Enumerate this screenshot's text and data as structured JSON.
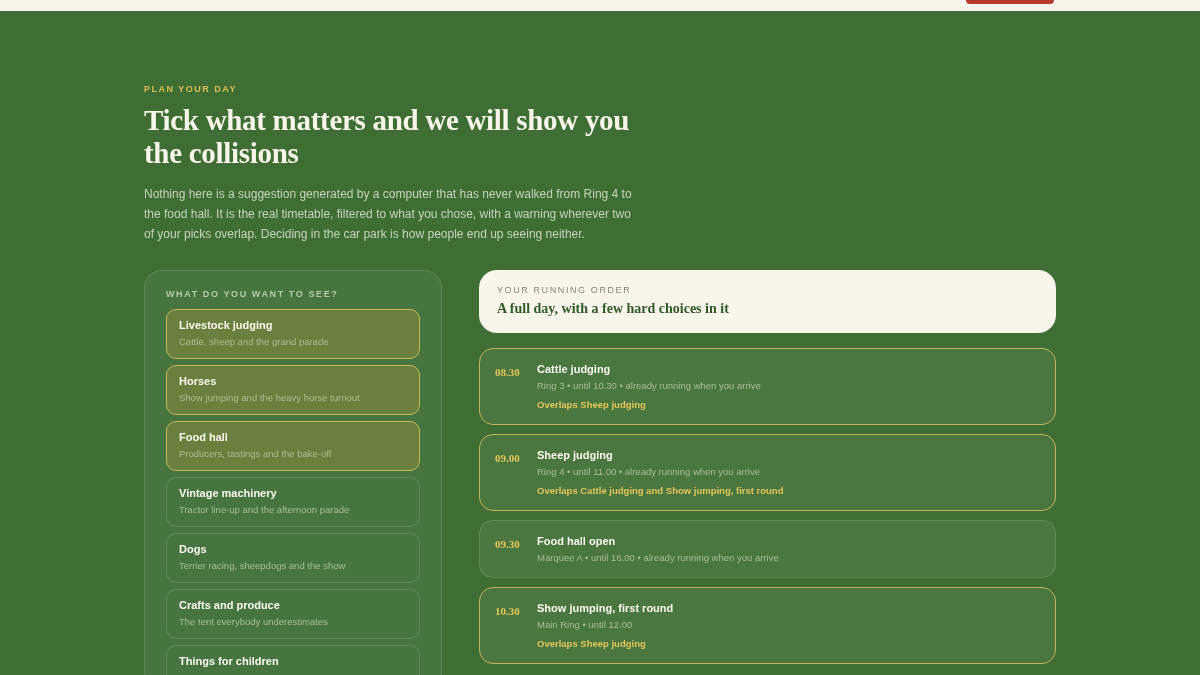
{
  "eyebrow": "PLAN YOUR DAY",
  "title": "Tick what matters and we will show you the collisions",
  "intro": "Nothing here is a suggestion generated by a computer that has never walked from Ring 4 to the food hall. It is the real timetable, filtered to what you chose, with a warning wherever two of your picks overlap. Deciding in the car park is how people end up seeing neither.",
  "picker": {
    "heading": "WHAT DO YOU WANT TO SEE?",
    "items": [
      {
        "title": "Livestock judging",
        "desc": "Cattle, sheep and the grand parade",
        "selected": true
      },
      {
        "title": "Horses",
        "desc": "Show jumping and the heavy horse turnout",
        "selected": true
      },
      {
        "title": "Food hall",
        "desc": "Producers, tastings and the bake-off",
        "selected": true
      },
      {
        "title": "Vintage machinery",
        "desc": "Tractor line-up and the afternoon parade",
        "selected": false
      },
      {
        "title": "Dogs",
        "desc": "Terrier racing, sheepdogs and the show",
        "selected": false
      },
      {
        "title": "Crafts and produce",
        "desc": "The tent everybody underestimates",
        "selected": false
      },
      {
        "title": "Things for children",
        "selected": false
      }
    ]
  },
  "order": {
    "eyebrow": "YOUR RUNNING ORDER",
    "title": "A full day, with a few hard choices in it",
    "events": [
      {
        "time": "08.30",
        "name": "Cattle judging",
        "details": "Ring 3 • until 10.30 • already running when you arrive",
        "clash": true,
        "overlap": "Overlaps Sheep judging"
      },
      {
        "time": "09.00",
        "name": "Sheep judging",
        "details": "Ring 4 • until 11.00 • already running when you arrive",
        "clash": true,
        "overlap": "Overlaps Cattle judging and Show jumping, first round"
      },
      {
        "time": "09.30",
        "name": "Food hall open",
        "details": "Marquee A • until 16.00 • already running when you arrive",
        "clash": false
      },
      {
        "time": "10.30",
        "name": "Show jumping, first round",
        "details": "Main Ring • until 12.00",
        "clash": true,
        "overlap": "Overlaps Sheep judging"
      }
    ]
  }
}
